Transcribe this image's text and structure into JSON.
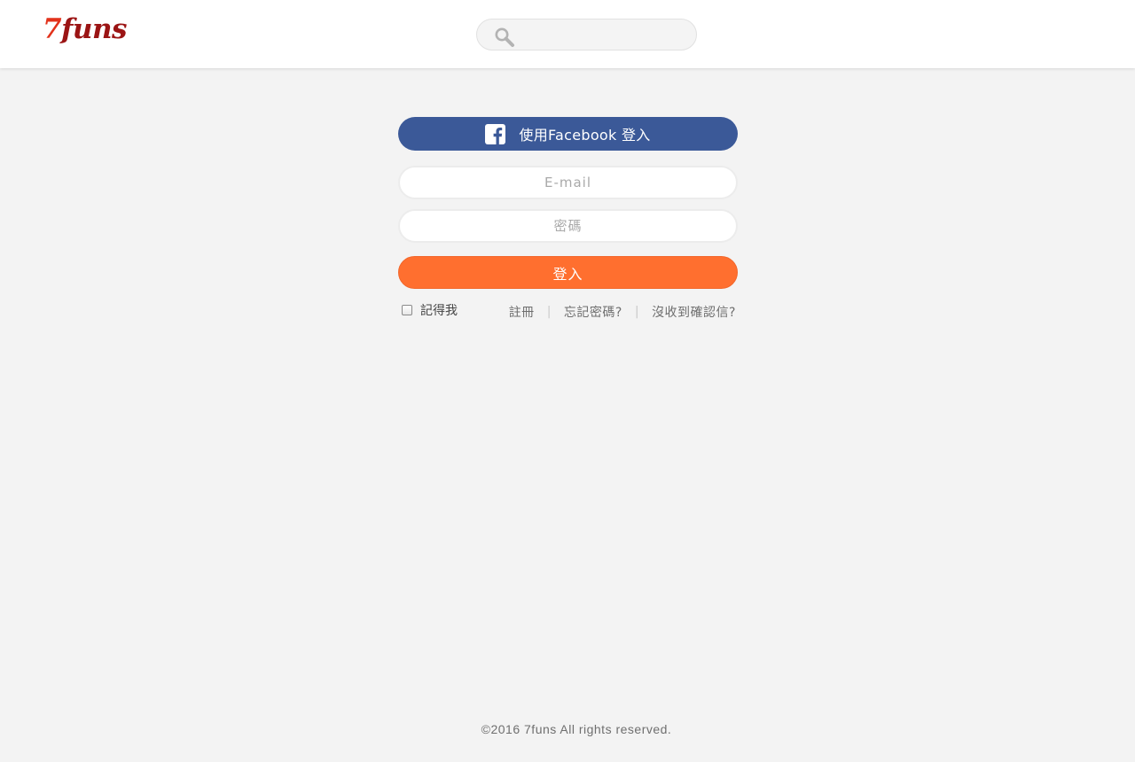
{
  "header": {
    "logo": {
      "seven": "7",
      "rest": "funs"
    },
    "search": {
      "placeholder": "",
      "icon": "search-icon"
    }
  },
  "login": {
    "facebook_button_label": "使用Facebook 登入",
    "facebook_icon": "facebook-icon",
    "email_placeholder": "E-mail",
    "password_placeholder": "密碼",
    "login_button_label": "登入",
    "remember_me_label": "記得我",
    "links": {
      "register": "註冊",
      "forgot_password": "忘記密碼?",
      "no_confirmation": "沒收到確認信?",
      "separator": "|"
    }
  },
  "footer": {
    "copyright": "©2016 7funs All rights reserved."
  },
  "colors": {
    "facebook_blue": "#3b5998",
    "login_orange": "#ff6f2f",
    "logo_red": "#e2321b",
    "logo_dark_red": "#9b1414",
    "page_background": "#f3f3f3"
  }
}
